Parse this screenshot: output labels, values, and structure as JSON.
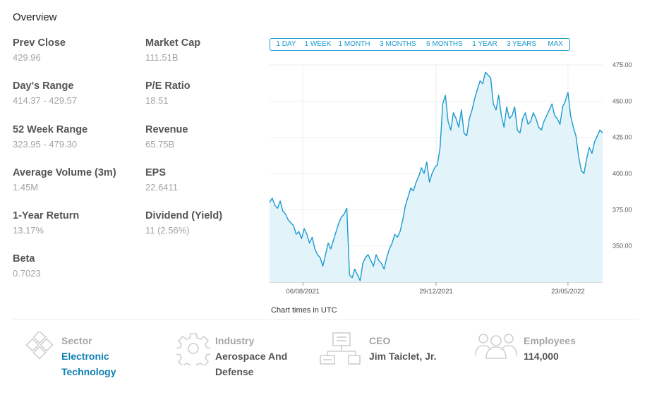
{
  "overview": {
    "title": "Overview"
  },
  "stats": [
    {
      "label": "Prev Close",
      "value": "429.96"
    },
    {
      "label": "Market Cap",
      "value": "111.51B"
    },
    {
      "label": "Day's Range",
      "value": "414.37 - 429.57"
    },
    {
      "label": "P/E Ratio",
      "value": "18.51"
    },
    {
      "label": "52 Week Range",
      "value": "323.95 - 479.30"
    },
    {
      "label": "Revenue",
      "value": "65.75B"
    },
    {
      "label": "Average Volume (3m)",
      "value": "1.45M"
    },
    {
      "label": "EPS",
      "value": "22.6411"
    },
    {
      "label": "1-Year Return",
      "value": "13.17%"
    },
    {
      "label": "Dividend (Yield)",
      "value": "11 (2.56%)"
    },
    {
      "label": "Beta",
      "value": "0.7023"
    }
  ],
  "range_tabs": [
    "1 DAY",
    "1 WEEK",
    "1 MONTH",
    "3 MONTHS",
    "6 MONTHS",
    "1 YEAR",
    "3 YEARS",
    "MAX"
  ],
  "active_range": "1 YEAR",
  "chart_note": "Chart times in UTC",
  "colors": {
    "accent": "#1a9bd0",
    "area_fill": "#e3f3fa",
    "grid": "#eeeeee"
  },
  "chart_data": {
    "type": "area",
    "y_ticks": [
      "475.00",
      "450.00",
      "425.00",
      "400.00",
      "375.00",
      "350.00"
    ],
    "x_ticks": [
      "06/08/2021",
      "29/12/2021",
      "23/05/2022"
    ],
    "ylim": [
      325,
      475
    ],
    "xlim": [
      0,
      250
    ],
    "grid": true,
    "x_tick_positions": [
      25,
      125,
      224
    ],
    "x": [
      0,
      2,
      4,
      6,
      8,
      10,
      12,
      14,
      16,
      18,
      20,
      22,
      24,
      26,
      28,
      30,
      32,
      34,
      36,
      38,
      40,
      42,
      44,
      46,
      48,
      50,
      52,
      54,
      56,
      58,
      60,
      62,
      64,
      66,
      68,
      70,
      72,
      74,
      76,
      78,
      80,
      82,
      84,
      86,
      88,
      90,
      92,
      94,
      96,
      98,
      100,
      102,
      104,
      106,
      108,
      110,
      112,
      114,
      116,
      118,
      120,
      122,
      124,
      126,
      128,
      130,
      132,
      134,
      136,
      138,
      140,
      142,
      144,
      146,
      148,
      150,
      152,
      154,
      156,
      158,
      160,
      162,
      164,
      166,
      168,
      170,
      172,
      174,
      176,
      178,
      180,
      182,
      184,
      186,
      188,
      190,
      192,
      194,
      196,
      198,
      200,
      202,
      204,
      206,
      208,
      210,
      212,
      214,
      216,
      218,
      220,
      222,
      224,
      226,
      228,
      230,
      232,
      234,
      236,
      238,
      240,
      242,
      244,
      246,
      248,
      250
    ],
    "values": [
      380,
      383,
      378,
      376,
      381,
      374,
      372,
      368,
      366,
      364,
      358,
      360,
      355,
      362,
      358,
      352,
      356,
      348,
      344,
      342,
      336,
      344,
      352,
      348,
      354,
      360,
      366,
      370,
      372,
      376,
      330,
      328,
      334,
      330,
      326,
      338,
      342,
      344,
      340,
      336,
      344,
      340,
      338,
      334,
      342,
      348,
      352,
      358,
      356,
      360,
      368,
      378,
      384,
      390,
      388,
      394,
      398,
      404,
      400,
      408,
      394,
      400,
      404,
      406,
      418,
      448,
      454,
      436,
      430,
      442,
      438,
      432,
      444,
      428,
      426,
      438,
      444,
      452,
      458,
      464,
      462,
      470,
      468,
      466,
      448,
      444,
      454,
      440,
      432,
      446,
      438,
      440,
      446,
      430,
      428,
      438,
      442,
      434,
      436,
      442,
      438,
      432,
      430,
      436,
      440,
      444,
      448,
      440,
      438,
      434,
      446,
      450,
      456,
      440,
      432,
      426,
      412,
      402,
      400,
      410,
      418,
      414,
      422,
      426,
      430,
      428
    ]
  },
  "info": [
    {
      "label": "Sector",
      "value": "Electronic Technology",
      "icon": "sector-icon",
      "link": true
    },
    {
      "label": "Industry",
      "value": "Aerospace And Defense",
      "icon": "industry-gear-icon",
      "link": false
    },
    {
      "label": "CEO",
      "value": "Jim Taiclet, Jr.",
      "icon": "ceo-org-chart-icon",
      "link": false
    },
    {
      "label": "Employees",
      "value": "114,000",
      "icon": "employees-people-icon",
      "link": false
    }
  ]
}
